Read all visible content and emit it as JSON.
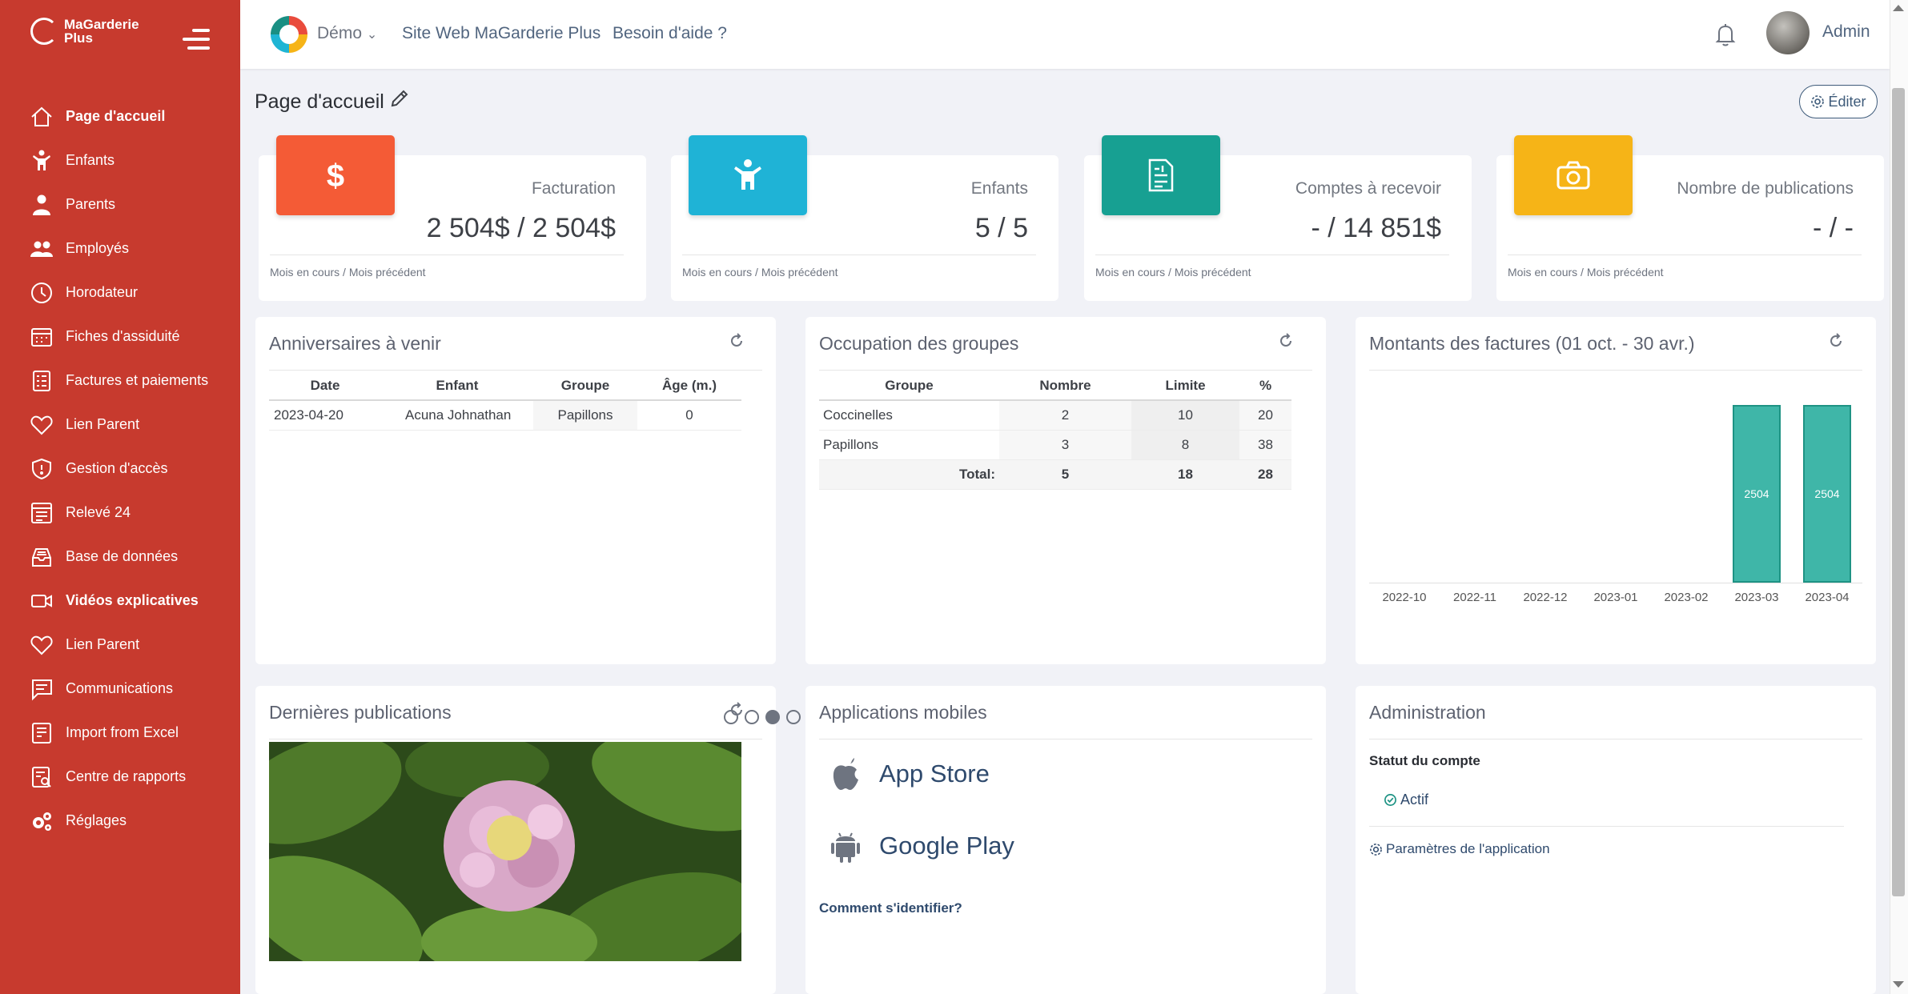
{
  "app": {
    "brand_line1": "MaGarderie",
    "brand_line2": "Plus"
  },
  "topbar": {
    "demo": "Démo",
    "site_link": "Site Web MaGarderie Plus",
    "help_link": "Besoin d'aide ?",
    "user": "Admin"
  },
  "sidebar": {
    "items": [
      {
        "label": "Page d'accueil",
        "icon": "home-icon"
      },
      {
        "label": "Enfants",
        "icon": "child-icon"
      },
      {
        "label": "Parents",
        "icon": "parent-icon"
      },
      {
        "label": "Employés",
        "icon": "employees-icon"
      },
      {
        "label": "Horodateur",
        "icon": "clock-icon"
      },
      {
        "label": "Fiches d'assiduité",
        "icon": "calendar-icon"
      },
      {
        "label": "Factures et paiements",
        "icon": "invoice-icon"
      },
      {
        "label": "Lien Parent",
        "icon": "heart-icon"
      },
      {
        "label": "Gestion d'accès",
        "icon": "shield-icon"
      },
      {
        "label": "Relevé 24",
        "icon": "form-icon"
      },
      {
        "label": "Base de données",
        "icon": "database-icon"
      },
      {
        "label": "Vidéos explicatives",
        "icon": "video-icon"
      },
      {
        "label": "Lien Parent",
        "icon": "heart-icon"
      },
      {
        "label": "Communications",
        "icon": "message-icon"
      },
      {
        "label": "Import from Excel",
        "icon": "import-icon"
      },
      {
        "label": "Centre de rapports",
        "icon": "report-icon"
      },
      {
        "label": "Réglages",
        "icon": "gears-icon"
      }
    ]
  },
  "page": {
    "title": "Page d'accueil",
    "edit_label": "Éditer"
  },
  "stats": [
    {
      "label": "Facturation",
      "value": "2 504$ / 2 504$",
      "foot": "Mois en cours / Mois précédent",
      "color": "#f45b36",
      "icon": "dollar-icon"
    },
    {
      "label": "Enfants",
      "value": "5 / 5",
      "foot": "Mois en cours / Mois précédent",
      "color": "#1fb3d6",
      "icon": "child-icon"
    },
    {
      "label": "Comptes à recevoir",
      "value": "- / 14 851$",
      "foot": "Mois en cours / Mois précédent",
      "color": "#17a092",
      "icon": "receipt-icon"
    },
    {
      "label": "Nombre de publications",
      "value": "- / -",
      "foot": "Mois en cours / Mois précédent",
      "color": "#f6b417",
      "icon": "camera-icon"
    }
  ],
  "birthdays": {
    "title": "Anniversaires à venir",
    "headers": [
      "Date",
      "Enfant",
      "Groupe",
      "Âge (m.)"
    ],
    "rows": [
      [
        "2023-04-20",
        "Acuna Johnathan",
        "Papillons",
        "0"
      ]
    ]
  },
  "groups": {
    "title": "Occupation des groupes",
    "headers": [
      "Groupe",
      "Nombre",
      "Limite",
      "%"
    ],
    "rows": [
      [
        "Coccinelles",
        "2",
        "10",
        "20"
      ],
      [
        "Papillons",
        "3",
        "8",
        "38"
      ]
    ],
    "total": [
      "Total:",
      "5",
      "18",
      "28"
    ]
  },
  "invoices": {
    "title": "Montants des factures (01 oct. - 30 avr.)"
  },
  "chart_data": {
    "type": "bar",
    "categories": [
      "2022-10",
      "2022-11",
      "2022-12",
      "2023-01",
      "2023-02",
      "2023-03",
      "2023-04"
    ],
    "values": [
      0,
      0,
      0,
      0,
      0,
      2504,
      2504
    ],
    "title": "Montants des factures (01 oct. - 30 avr.)",
    "xlabel": "",
    "ylabel": "",
    "data_labels": [
      "",
      "",
      "",
      "",
      "",
      "2504",
      "2504"
    ],
    "bar_color": "#3fb6a8",
    "grid": false
  },
  "publications": {
    "title": "Dernières publications",
    "slide_count": 5,
    "active_slide": 3
  },
  "mobile": {
    "title": "Applications mobiles",
    "app_store": "App Store",
    "google_play": "Google Play",
    "login_help": "Comment s'identifier?"
  },
  "admin": {
    "title": "Administration",
    "status_heading": "Statut du compte",
    "status": "Actif",
    "settings_link": "Paramètres de l'application"
  }
}
